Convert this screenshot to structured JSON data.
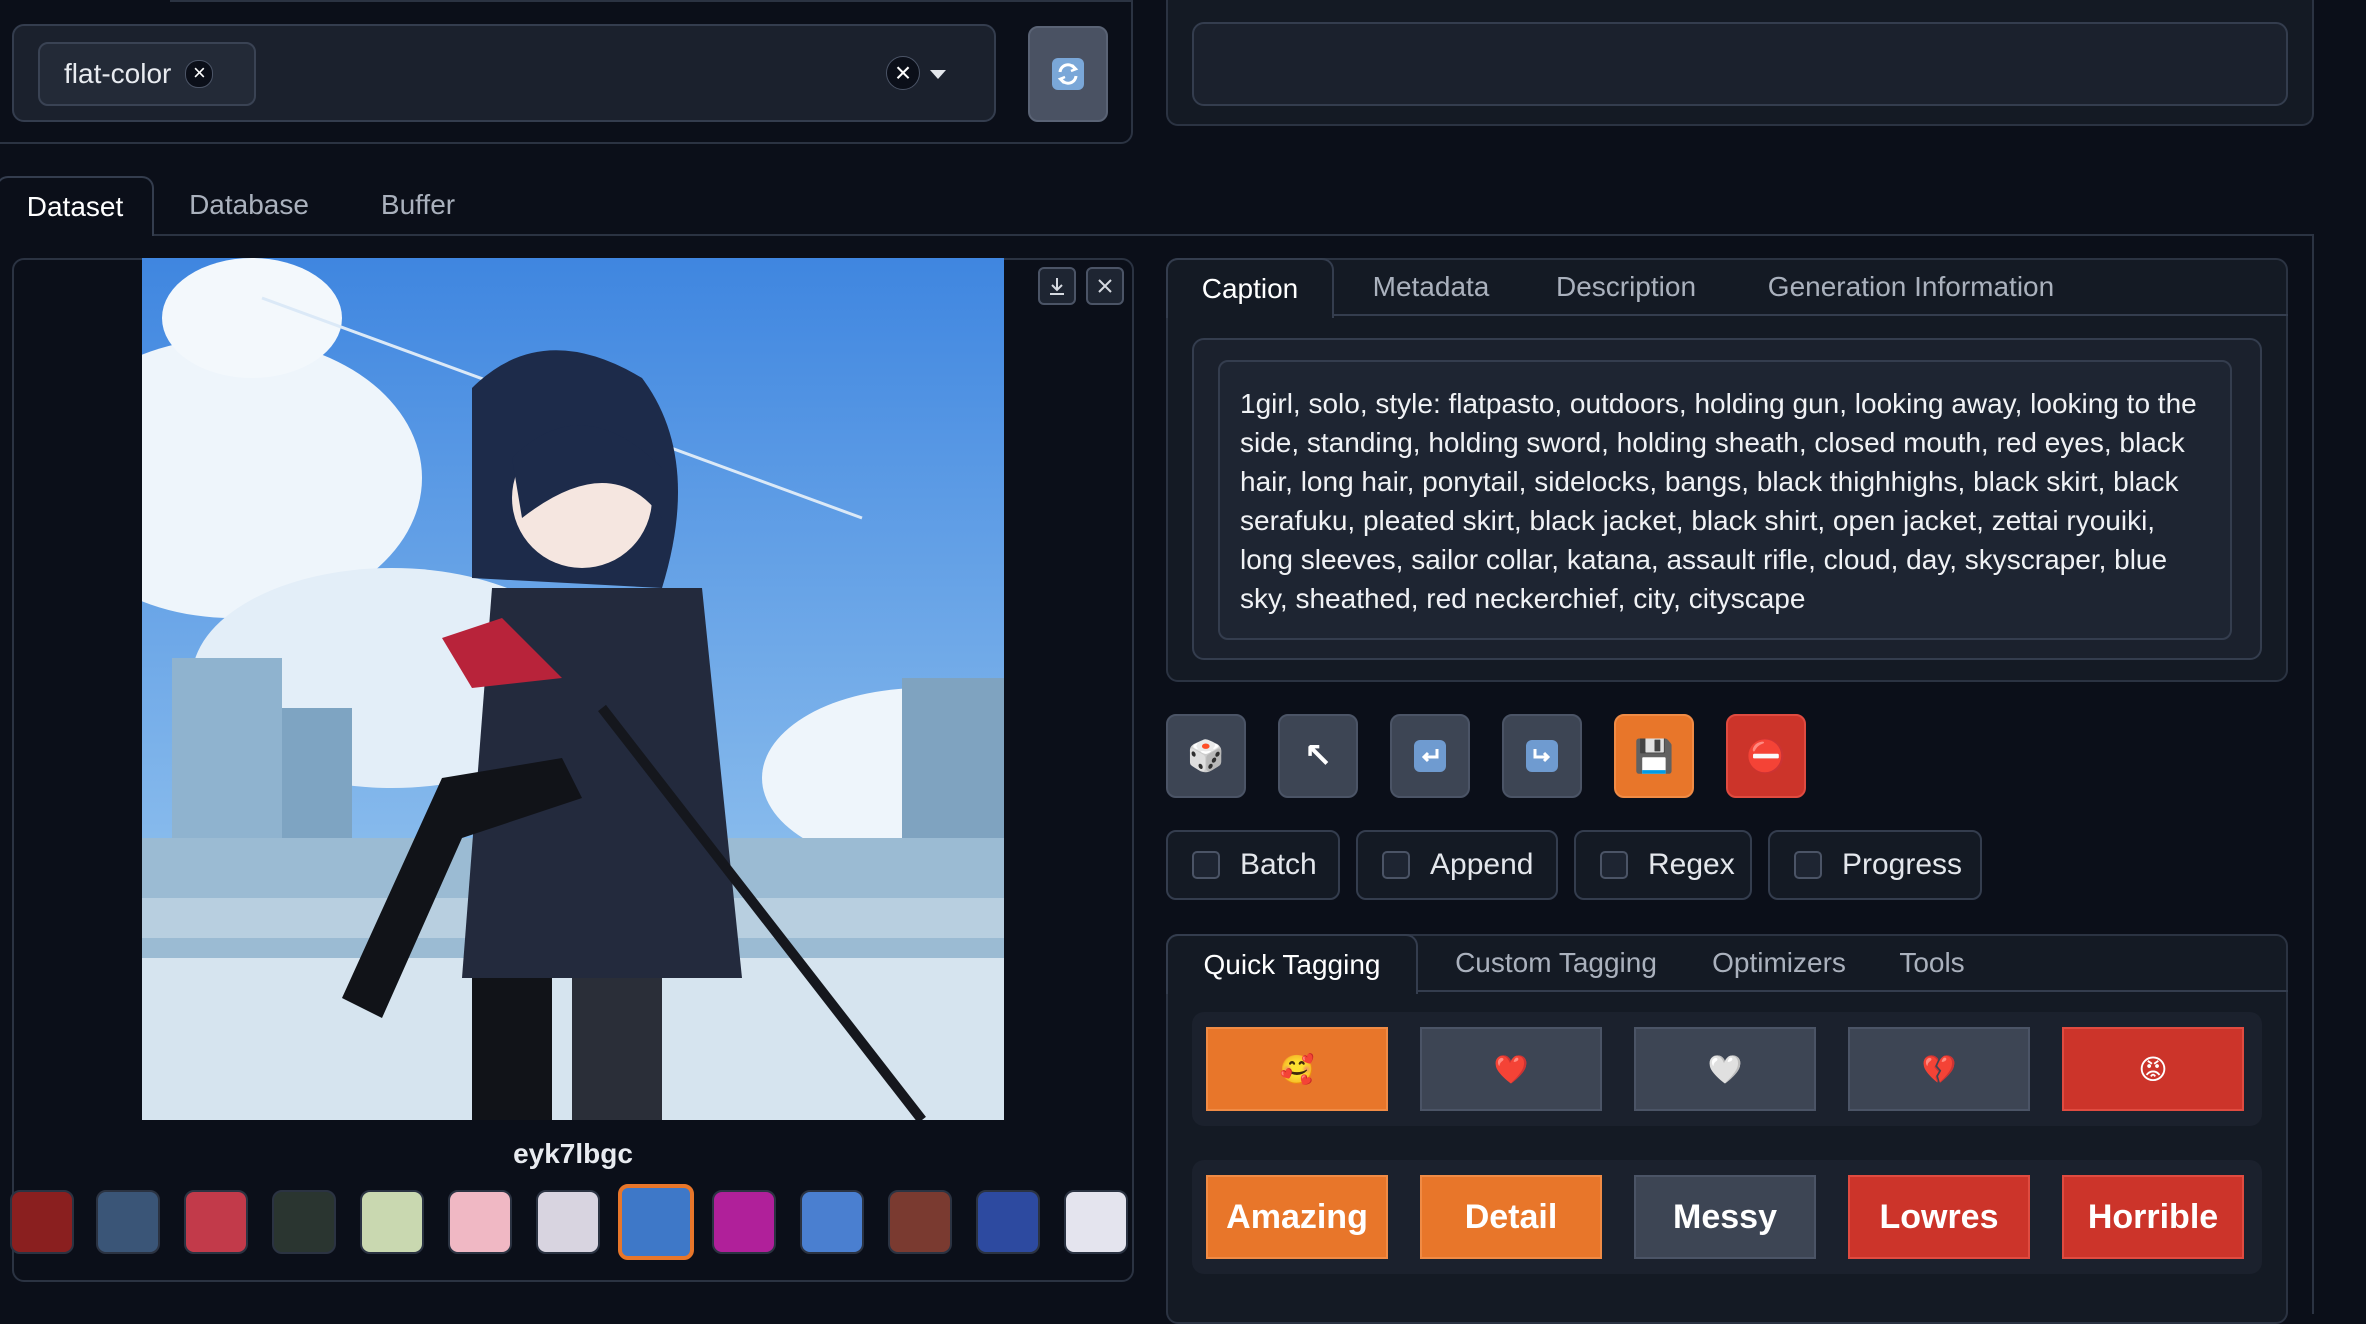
{
  "tag_filter": {
    "chip_label": "flat-color",
    "chip_remove": "×",
    "clear_icon": "×"
  },
  "main_tabs": [
    "Dataset",
    "Database",
    "Buffer"
  ],
  "image_viewer": {
    "filename": "eyk7lbgc"
  },
  "caption_tabs": [
    "Caption",
    "Metadata",
    "Description",
    "Generation Information"
  ],
  "caption_text": "1girl, solo, style: flatpasto, outdoors, holding gun, looking away, looking to the side, standing, holding sword, holding sheath, closed mouth, red eyes, black hair, long hair, ponytail, sidelocks, bangs, black thighhighs, black skirt, black serafuku, pleated skirt, black jacket, black shirt, open jacket, zettai ryouiki, long sleeves, sailor collar, katana, assault rifle, cloud, day, skyscraper, blue sky, sheathed, red neckerchief, city, cityscape",
  "action_buttons": [
    {
      "icon": "🎲",
      "name": "dice"
    },
    {
      "icon": "↖",
      "name": "arrow-up-left"
    },
    {
      "icon": "⮐",
      "name": "undo"
    },
    {
      "icon": "⮑",
      "name": "redo"
    },
    {
      "icon": "💾",
      "name": "floppy-disk"
    },
    {
      "icon": "⛔",
      "name": "no-entry"
    }
  ],
  "options": [
    "Batch",
    "Append",
    "Regex",
    "Progress"
  ],
  "tagging_tabs": [
    "Quick Tagging",
    "Custom Tagging",
    "Optimizers",
    "Tools"
  ],
  "emoji_ratings": [
    "🥰",
    "❤️",
    "🤍",
    "💔",
    "😡"
  ],
  "quality_ratings": [
    "Amazing",
    "Detail",
    "Messy",
    "Lowres",
    "Horrible"
  ],
  "colors": {
    "orange": "#e8762a",
    "red": "#cc342a",
    "gray": "#3d4554",
    "background": "#0b0f19"
  }
}
